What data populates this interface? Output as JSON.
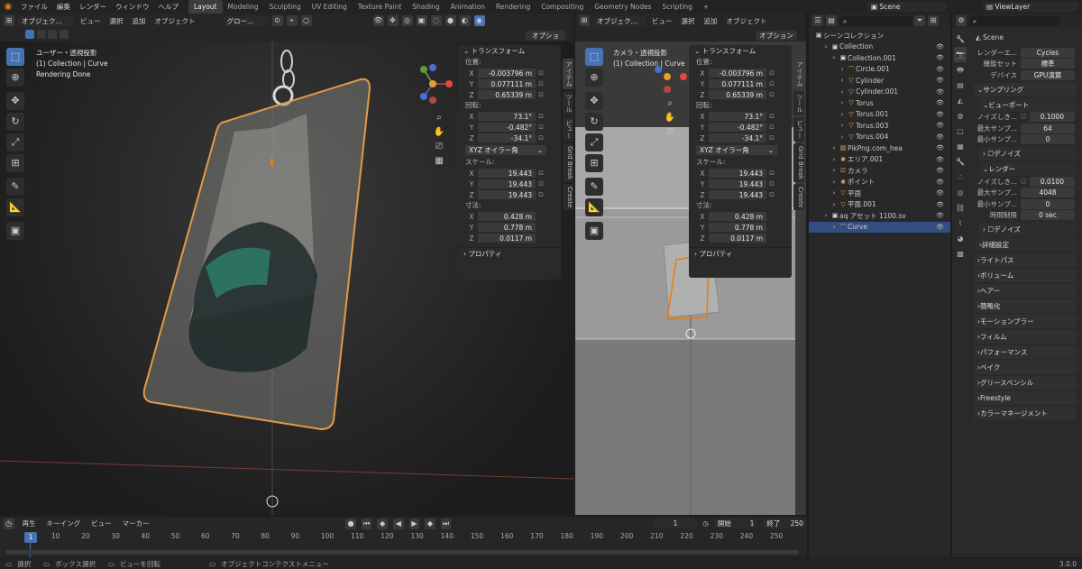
{
  "topbar": {
    "menus": [
      "ファイル",
      "編集",
      "レンダー",
      "ウィンドウ",
      "ヘルプ"
    ],
    "workspaces": [
      "Layout",
      "Modeling",
      "Sculpting",
      "UV Editing",
      "Texture Paint",
      "Shading",
      "Animation",
      "Rendering",
      "Compositing",
      "Geometry Nodes",
      "Scripting"
    ],
    "active_workspace": "Layout",
    "add_tab": "+",
    "scene": "Scene",
    "view_layer": "ViewLayer"
  },
  "viewport_left": {
    "header": {
      "mode": "オブジェク...",
      "menus": [
        "ビュー",
        "選択",
        "追加",
        "オブジェクト"
      ],
      "transform_orientation": "グロー...",
      "options": "オプション"
    },
    "overlay": {
      "line1": "ユーザー・透視投影",
      "line2": "(1) Collection | Curve",
      "line3": "Rendering Done"
    },
    "tabs": [
      "アイテム",
      "ツール",
      "ビュー",
      "Grid Break",
      "Create"
    ]
  },
  "viewport_right": {
    "header": {
      "mode": "オブジェク...",
      "menus": [
        "ビュー",
        "選択",
        "追加",
        "オブジェクト"
      ],
      "options": "オプション"
    },
    "overlay": {
      "line1": "カメラ・透視投影",
      "line2": "(1) Collection | Curve"
    },
    "tabs": [
      "アイテム",
      "ツール",
      "ビュー",
      "Grid Break",
      "Create"
    ]
  },
  "transform": {
    "title": "トランスフォーム",
    "location_label": "位置:",
    "location": {
      "x": "-0.003796 m",
      "y": "0.077111 m",
      "z": "0.65339 m"
    },
    "rotation_label": "回転:",
    "rotation": {
      "x": "73.1°",
      "y": "-0.482°",
      "z": "-34.1°"
    },
    "rotation_mode": "XYZ オイラー角",
    "scale_label": "スケール:",
    "scale": {
      "x": "19.443",
      "y": "19.443",
      "z": "19.443"
    },
    "dimensions_label": "寸法:",
    "dimensions": {
      "x": "0.428 m",
      "y": "0.778 m",
      "z": "0.0117 m"
    },
    "properties": "プロパティ",
    "axis_x": "X",
    "axis_y": "Y",
    "axis_z": "Z"
  },
  "outliner": {
    "root": "シーンコレクション",
    "items": [
      {
        "name": "Collection",
        "depth": 0,
        "icon": "collection-icon"
      },
      {
        "name": "Collection.001",
        "depth": 1,
        "icon": "collection-icon"
      },
      {
        "name": "Circle.001",
        "depth": 2,
        "icon": "curve-icon"
      },
      {
        "name": "Cylinder",
        "depth": 2,
        "icon": "mesh-icon"
      },
      {
        "name": "Cylinder.001",
        "depth": 2,
        "icon": "mesh-icon"
      },
      {
        "name": "Torus",
        "depth": 2,
        "icon": "mesh-icon"
      },
      {
        "name": "Torus.001",
        "depth": 2,
        "icon": "mesh-icon"
      },
      {
        "name": "Torus.003",
        "depth": 2,
        "icon": "mesh-icon"
      },
      {
        "name": "Torus.004",
        "depth": 2,
        "icon": "mesh-icon"
      },
      {
        "name": "PikPng.com_hea",
        "depth": 1,
        "icon": "image-icon"
      },
      {
        "name": "エリア.001",
        "depth": 1,
        "icon": "light-icon"
      },
      {
        "name": "カメラ",
        "depth": 1,
        "icon": "camera-icon"
      },
      {
        "name": "ポイント",
        "depth": 1,
        "icon": "light-icon"
      },
      {
        "name": "平面",
        "depth": 1,
        "icon": "mesh-icon"
      },
      {
        "name": "平面.001",
        "depth": 1,
        "icon": "mesh-icon"
      },
      {
        "name": "aq アセット 1100.sv",
        "depth": 0,
        "icon": "collection-icon"
      },
      {
        "name": "Curve",
        "depth": 1,
        "icon": "curve-icon",
        "selected": true
      }
    ]
  },
  "properties": {
    "scene": "Scene",
    "render_engine_label": "レンダーエ...",
    "render_engine": "Cycles",
    "feature_set_label": "機能セット",
    "feature_set": "標準",
    "device_label": "デバイス",
    "device": "GPU演算",
    "sampling": "サンプリング",
    "viewport": "ビューポート",
    "noise_label": "ノイズしき...",
    "viewport_noise": "0.1000",
    "max_samples_label": "最大サンプ...",
    "viewport_max": "64",
    "min_samples_label": "最小サンプ...",
    "viewport_min": "0",
    "denoise": "デノイズ",
    "render": "レンダー",
    "render_noise": "0.0100",
    "render_max": "4048",
    "render_min": "0",
    "time_limit_label": "時間制限",
    "time_limit": "0 sec",
    "denoise2": "デノイズ",
    "advanced": "詳細設定",
    "sections": [
      "ライトパス",
      "ボリューム",
      "ヘアー",
      "簡略化",
      "モーションブラー",
      "フィルム",
      "パフォーマンス",
      "ベイク",
      "グリースペンシル",
      "Freestyle",
      "カラーマネージメント"
    ]
  },
  "timeline": {
    "menus": [
      "再生",
      "キーイング",
      "ビュー",
      "マーカー"
    ],
    "current_frame": "1",
    "start_label": "開始",
    "start": "1",
    "end_label": "終了",
    "end": "250",
    "ticks": [
      "1",
      "10",
      "20",
      "30",
      "40",
      "50",
      "60",
      "70",
      "80",
      "90",
      "100",
      "110",
      "120",
      "130",
      "140",
      "150",
      "160",
      "170",
      "180",
      "190",
      "200",
      "210",
      "220",
      "230",
      "240",
      "250"
    ]
  },
  "statusbar": {
    "select": "選択",
    "box_select": "ボックス選択",
    "rotate_view": "ビューを回転",
    "context_menu": "オブジェクトコンテクストメニュー",
    "version": "3.0.0"
  },
  "colors": {
    "accent": "#4772b3",
    "selection": "#e87d0d",
    "panel": "#2a2a2a"
  }
}
